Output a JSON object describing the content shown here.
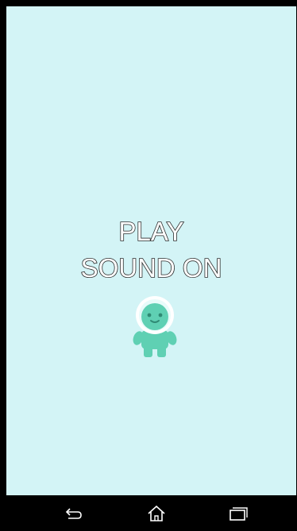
{
  "menu": {
    "play_label": "PLAY",
    "sound_label": "SOUND ON"
  },
  "mascot": {
    "icon": "alien-mascot-icon",
    "body_color": "#5fd0b3",
    "dark_color": "#3fb396",
    "helmet_color": "#ffffff"
  },
  "navbar": {
    "back_icon": "back-icon",
    "home_icon": "home-icon",
    "recent_icon": "recent-apps-icon"
  },
  "colors": {
    "background": "#d3f4f6",
    "navbar": "#000000",
    "text_fill": "#ffffff",
    "text_outline": "#2b2b2b"
  }
}
